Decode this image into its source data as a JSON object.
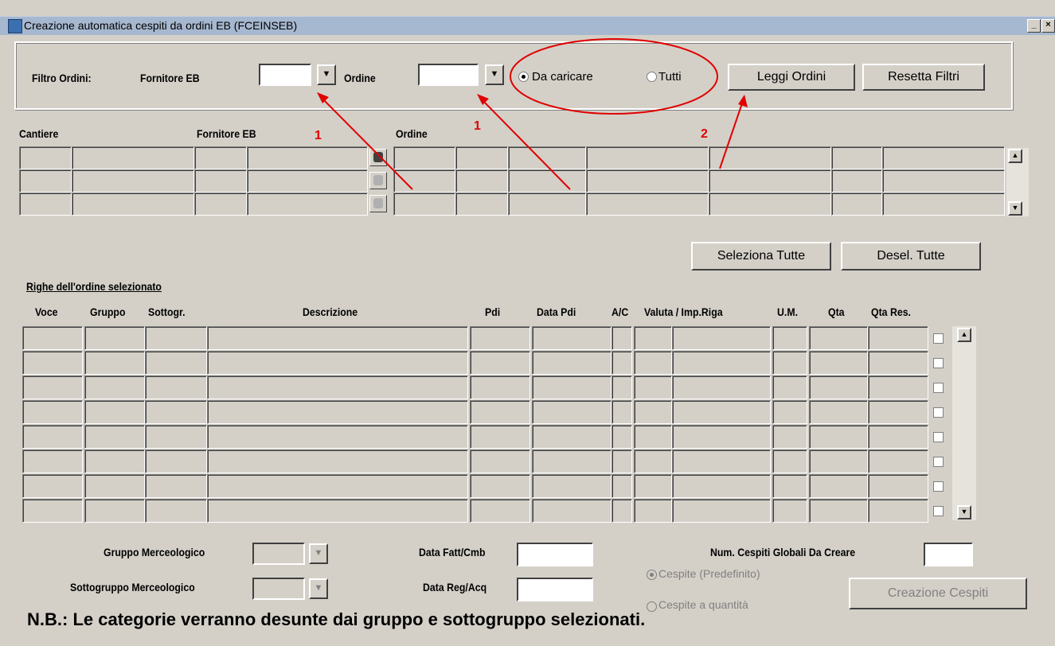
{
  "window": {
    "title": "Creazione automatica cespiti da ordini EB (FCEINSEB)"
  },
  "filter": {
    "label": "Filtro Ordini:",
    "fornitore_label": "Fornitore EB",
    "fornitore_value": "",
    "ordine_label": "Ordine",
    "ordine_value": "",
    "radio_da_caricare": "Da caricare",
    "radio_tutti": "Tutti",
    "selected": "Da caricare",
    "leggi_button": "Leggi Ordini",
    "reset_button": "Resetta Filtri"
  },
  "orders_grid": {
    "headers": {
      "cantiere": "Cantiere",
      "fornitore": "Fornitore EB",
      "ordine": "Ordine"
    },
    "row_count": 3
  },
  "selection": {
    "select_all": "Seleziona Tutte",
    "deselect_all": "Desel. Tutte"
  },
  "lines_grid": {
    "title": "Righe dell'ordine selezionato",
    "headers": [
      "Voce",
      "Gruppo",
      "Sottogr.",
      "Descrizione",
      "Pdi",
      "Data Pdi",
      "A/C",
      "Valuta / Imp.Riga",
      "U.M.",
      "Qta",
      "Qta Res."
    ],
    "row_count": 8
  },
  "bottom": {
    "gruppo_label": "Gruppo Merceologico",
    "sottogruppo_label": "Sottogruppo Merceologico",
    "data_fatt_label": "Data Fatt/Cmb",
    "data_reg_label": "Data Reg/Acq",
    "num_cespiti_label": "Num. Cespiti Globali Da Creare",
    "radio_predefinito": "Cespite (Predefinito)",
    "radio_quantita": "Cespite a quantità",
    "creazione_button": "Creazione Cespiti"
  },
  "note": "N.B.: Le categorie verranno desunte dai gruppo e sottogruppo selezionati.",
  "annotations": {
    "label_1": "1",
    "label_2": "2",
    "color": "#e00000"
  },
  "icons": {
    "window_icon": "app-icon",
    "dropdown": "chevron-down-icon"
  }
}
